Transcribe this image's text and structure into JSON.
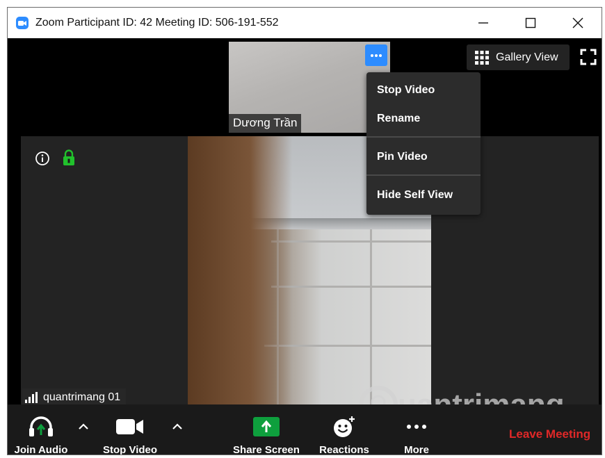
{
  "window": {
    "title": "Zoom Participant ID: 42   Meeting ID: 506-191-552"
  },
  "thumbnail": {
    "name": "Dương Trần"
  },
  "top_controls": {
    "gallery_view_label": "Gallery View"
  },
  "context_menu": {
    "items": [
      {
        "label": "Stop Video"
      },
      {
        "label": "Rename"
      },
      {
        "label": "Pin Video"
      },
      {
        "label": "Hide Self View"
      }
    ]
  },
  "main_video": {
    "self_name": "quantrimang 01"
  },
  "watermark": {
    "text": "uantrimang"
  },
  "toolbar": {
    "join_audio": "Join Audio",
    "stop_video": "Stop Video",
    "share_screen": "Share Screen",
    "reactions": "Reactions",
    "more": "More",
    "leave_meeting": "Leave Meeting"
  },
  "colors": {
    "accent_blue": "#2d8cff",
    "share_green": "#0e9f3d",
    "leave_red": "#e02828",
    "lock_green": "#21c12c"
  }
}
